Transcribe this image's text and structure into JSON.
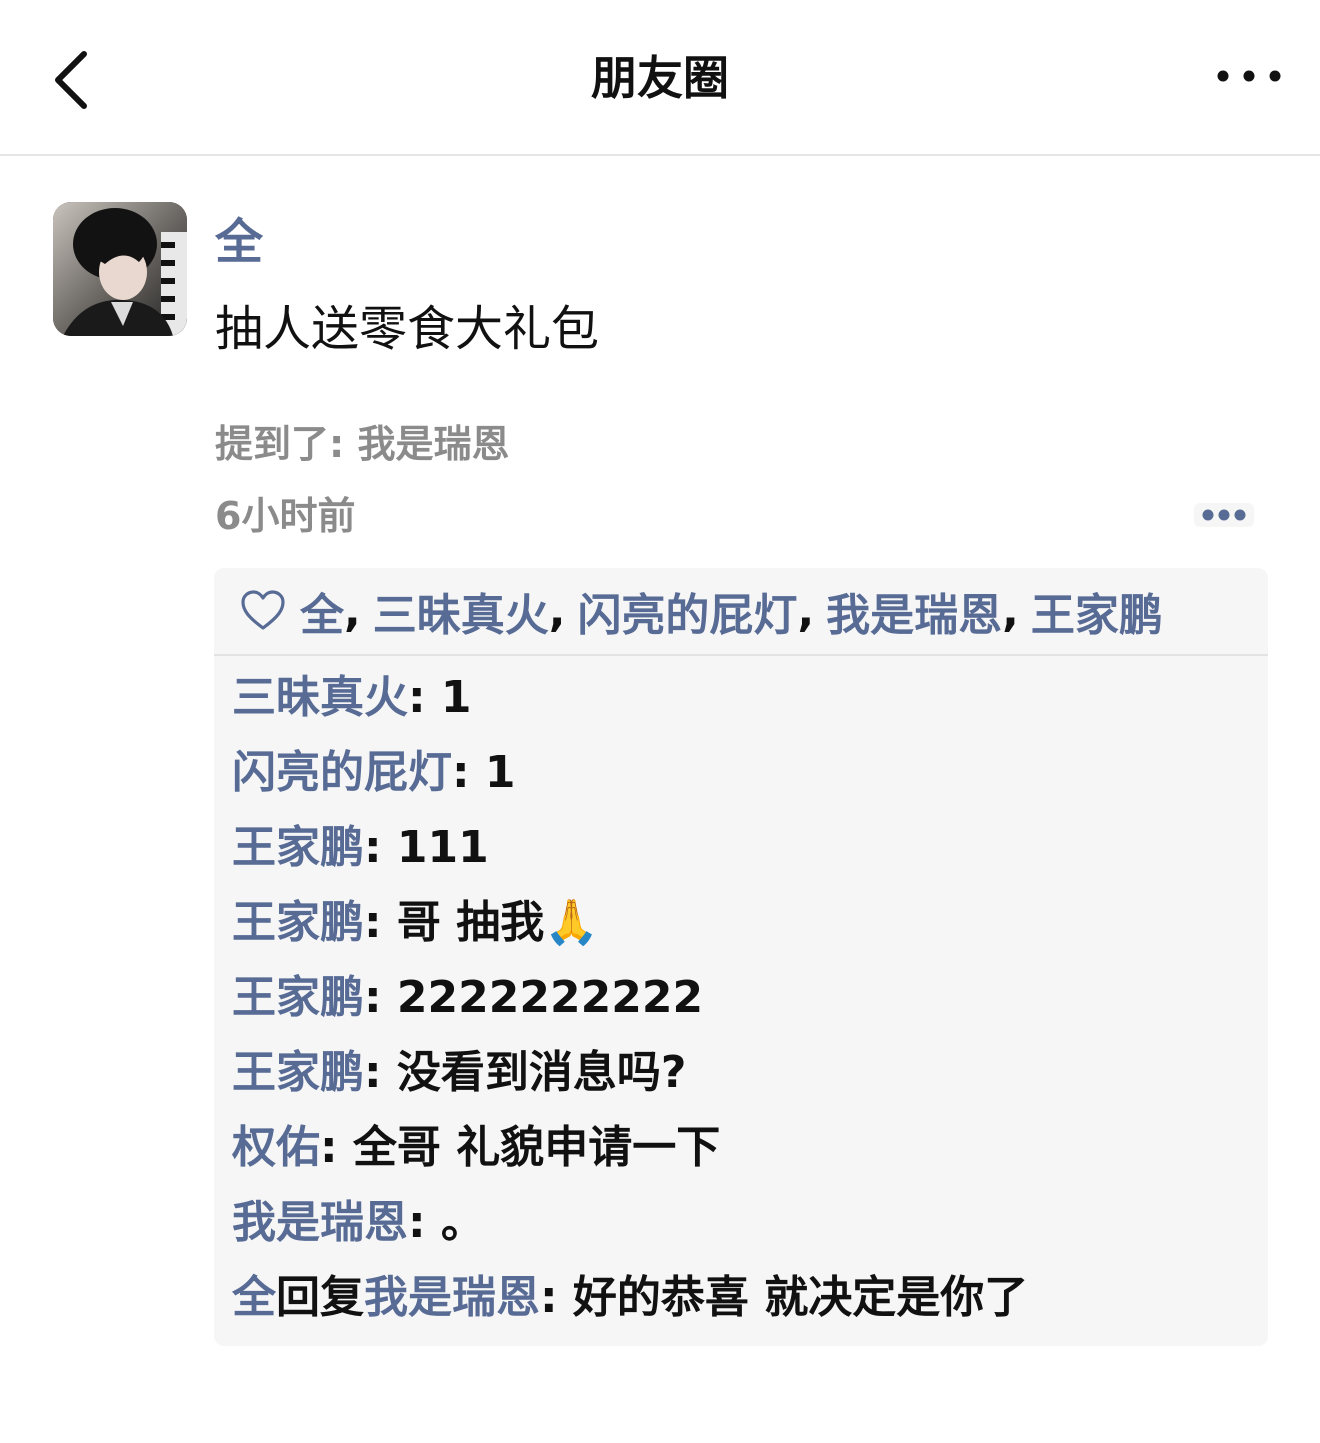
{
  "nav": {
    "title": "朋友圈"
  },
  "post": {
    "author": "全",
    "text": "抽人送零食大礼包",
    "mention_label": "提到了: ",
    "mention_name": "我是瑞恩",
    "time": "6小时前"
  },
  "likes": [
    {
      "name": "全",
      "sep": ","
    },
    {
      "name": "三昧真火",
      "sep": ","
    },
    {
      "name": "闪亮的屁灯",
      "sep": ","
    },
    {
      "name": "我是瑞恩",
      "sep": ","
    },
    {
      "name": "王家鹏",
      "sep": ""
    }
  ],
  "comments": [
    {
      "name": "三昧真火",
      "colon": ": ",
      "text": "1"
    },
    {
      "name": "闪亮的屁灯",
      "colon": ": ",
      "text": "1"
    },
    {
      "name": "王家鹏",
      "colon": ": ",
      "text": "111"
    },
    {
      "name": "王家鹏",
      "colon": ": ",
      "text": "哥 抽我🙏"
    },
    {
      "name": "王家鹏",
      "colon": ": ",
      "text": "2222222222"
    },
    {
      "name": "王家鹏",
      "colon": ": ",
      "text": "没看到消息吗?"
    },
    {
      "name": "权佑",
      "colon": ": ",
      "text": "全哥 礼貌申请一下"
    },
    {
      "name": "我是瑞恩",
      "colon": ": ",
      "text": "。"
    }
  ],
  "reply_comment": {
    "name": "全",
    "reply_word": "回复",
    "target": "我是瑞恩",
    "colon": ": ",
    "text": "好的恭喜 就决定是你了"
  },
  "colors": {
    "link": "#576b95",
    "text": "#111111",
    "muted": "#8b8b8b",
    "panel": "#f6f6f6"
  }
}
